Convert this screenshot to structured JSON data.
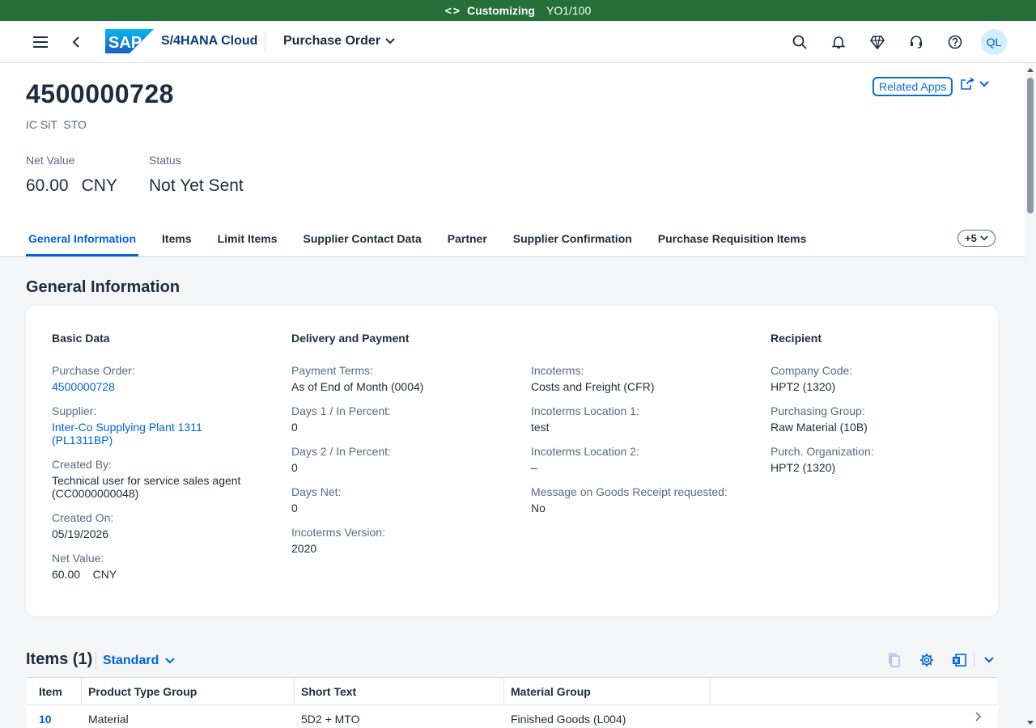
{
  "env_bar": {
    "label": "Customizing",
    "client": "YO1/100"
  },
  "shell": {
    "product": "S/4HANA Cloud",
    "app_title": "Purchase Order",
    "avatar": "QL"
  },
  "header": {
    "title": "4500000728",
    "subtitle": "IC SiT  STO",
    "related_apps": "Related Apps",
    "net_value_label": "Net Value",
    "net_value": "60.00",
    "net_value_unit": "CNY",
    "status_label": "Status",
    "status": "Not Yet Sent"
  },
  "tabs": [
    "General Information",
    "Items",
    "Limit Items",
    "Supplier Contact Data",
    "Partner",
    "Supplier Confirmation",
    "Purchase Requisition Items"
  ],
  "more_tabs": "+5",
  "general": {
    "title": "General Information",
    "basic": {
      "title": "Basic Data",
      "po_label": "Purchase Order:",
      "po_value": "4500000728",
      "supplier_label": "Supplier:",
      "supplier_value": "Inter-Co Supplying Plant 1311 (PL1311BP)",
      "created_by_label": "Created By:",
      "created_by_value": "Technical user for service sales agent (CC0000000048)",
      "created_on_label": "Created On:",
      "created_on_value": "05/19/2026",
      "net_value_label": "Net Value:",
      "net_value_value": "60.00    CNY"
    },
    "delivery": {
      "title": "Delivery and Payment",
      "payment_terms_label": "Payment Terms:",
      "payment_terms_value": "As of End of Month (0004)",
      "days1_label": "Days 1 / In Percent:",
      "days1_value": "0",
      "days2_label": "Days 2 / In Percent:",
      "days2_value": "0",
      "days_net_label": "Days Net:",
      "days_net_value": "0",
      "incoterms_version_label": "Incoterms Version:",
      "incoterms_version_value": "2020",
      "incoterms_label": "Incoterms:",
      "incoterms_value": "Costs and Freight (CFR)",
      "incoterms_loc1_label": "Incoterms Location 1:",
      "incoterms_loc1_value": "test",
      "incoterms_loc2_label": "Incoterms Location 2:",
      "incoterms_loc2_value": "–",
      "gr_message_label": "Message on Goods Receipt requested:",
      "gr_message_value": "No"
    },
    "recipient": {
      "title": "Recipient",
      "company_code_label": "Company Code:",
      "company_code_value": "HPT2 (1320)",
      "purch_group_label": "Purchasing Group:",
      "purch_group_value": "Raw Material (10B)",
      "purch_org_label": "Purch. Organization:",
      "purch_org_value": "HPT2 (1320)"
    }
  },
  "items": {
    "title": "Items (1)",
    "variant": "Standard",
    "columns": [
      "Item",
      "Product Type Group",
      "Short Text",
      "Material Group"
    ],
    "rows": [
      {
        "item": "10",
        "product_type_group": "Material",
        "short_text": "5D2 + MTO",
        "material_group": "Finished Goods (L004)"
      }
    ]
  },
  "colors": {
    "env_bar": "#256f3a",
    "link": "#0064d9",
    "text": "#1d2d3e",
    "label": "#556b82"
  }
}
